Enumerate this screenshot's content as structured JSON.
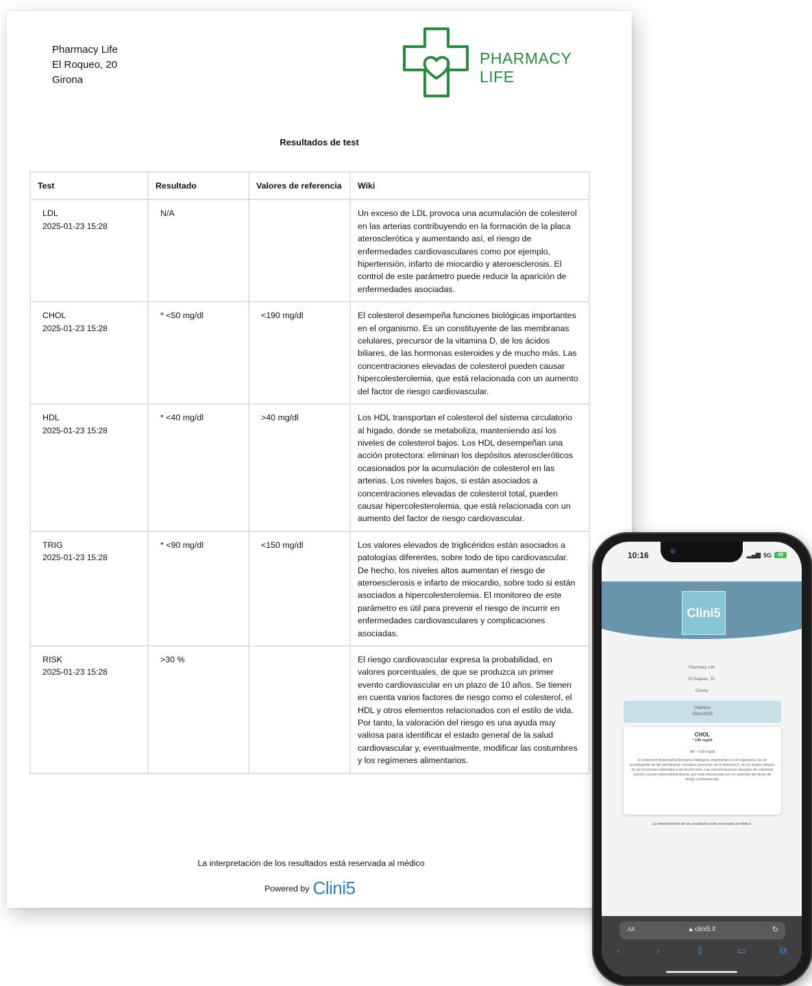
{
  "document": {
    "address": [
      "Pharmacy Life",
      "El Roqueo, 20",
      "Girona"
    ],
    "logo_text": [
      "PHARMACY",
      "LIFE"
    ],
    "colors": {
      "brand_green": "#2b8a3e",
      "clini5_blue": "#2e7fbf"
    },
    "title": "Resultados de test",
    "table": {
      "headers": [
        "Test",
        "Resultado",
        "Valores de referencia",
        "Wiki"
      ],
      "rows": [
        {
          "test": "LDL",
          "timestamp": "2025-01-23 15:28",
          "result": "N/A",
          "reference": "",
          "wiki": "Un exceso de LDL provoca una acumulación de colesterol en las arterias contribuyendo en la formación de la placa aterosclerótica y aumentando así, el riesgo de enfermedades cardiovasculares como por ejemplo, hipertensión, infarto de miocardio y ateroesclerosis. El control de este parámetro puede reducir la aparición de enfermedades asociadas."
        },
        {
          "test": "CHOL",
          "timestamp": "2025-01-23 15:28",
          "result": "* <50 mg/dl",
          "reference": "<190 mg/dl",
          "wiki": "El colesterol desempeña funciones biológicas importantes en el organismo. Es un constituyente de las membranas celulares, precursor de la vitamina D, de los ácidos biliares, de las hormonas esteroides y de mucho más. Las concentraciones elevadas de colesterol pueden causar hipercolesterolemia, que está relacionada con un aumento del factor de riesgo cardiovascular."
        },
        {
          "test": "HDL",
          "timestamp": "2025-01-23 15:28",
          "result": "* <40 mg/dl",
          "reference": ">40 mg/dl",
          "wiki": "Los HDL transportan el colesterol del sistema circulatorio al hígado, donde se metaboliza, manteniendo así los niveles de colesterol bajos. Los HDL desempeñan una acción protectora: eliminan los depósitos ateroscleróticos ocasionados por la acumulación de colesterol en las arterias. Los niveles bajos, si están asociados a concentraciones elevadas de colesterol total, pueden causar hipercolesterolemia, que está relacionada con un aumento del factor de riesgo cardiovascular."
        },
        {
          "test": "TRIG",
          "timestamp": "2025-01-23 15:28",
          "result": "* <90 mg/dl",
          "reference": "<150 mg/dl",
          "wiki": "Los valores elevados de triglicéridos están asociados a patologías diferentes, sobre todo de tipo cardiovascular. De hecho, los niveles altos aumentan el riesgo de ateroesclerosis e infarto de miocardio, sobre todo si están asociados a hipercolesterolemia. El monitoreo de este parámetro es útil para prevenir el riesgo de incurrir en enfermedades cardiovasculares y complicaciones asociadas."
        },
        {
          "test": "RISK",
          "timestamp": "2025-01-23 15:28",
          "result": ">30 %",
          "reference": "",
          "wiki": "El riesgo cardiovascular expresa la probabilidad, en valores porcentuales, de que se produzca un primer evento cardiovascular en un plazo de 10 años. Se tienen en cuenta varios factores de riesgo como el colesterol, el HDL y otros elementos relacionados con el estilo de vida. Por tanto, la valoración del riesgo es una ayuda muy valiosa para identificar el estado general de la salud cardiovascular y, eventualmente, modificar las costumbres y los regímenes alimentarios."
        }
      ]
    },
    "footer_note": "La interpretación de los resultados está reservada al médico",
    "powered_by": "Powered by",
    "powered_brand": "Clini5"
  },
  "phone": {
    "time": "10:16",
    "network": "5G",
    "battery": "45",
    "app_logo": "Clini5",
    "address": [
      "Pharmacy Life",
      "El Roqueo, 20",
      "Girona"
    ],
    "date_label": "Día/Hora",
    "date_value": "23/01/2025",
    "card": {
      "title": "CHOL",
      "value": "* 196 mg/dl",
      "reference": "MF: <190 mg/dl",
      "description": "El colesterol desempeña funciones biológicas importantes en el organismo. Es un constituyente de las membranas celulares, precursor de la vitamina D, de los ácidos biliares, de las hormonas esteroides y de mucho más. Las concentraciones elevadas de colesterol pueden causar hipercolesterolemia, que está relacionada con un aumento del factor de riesgo cardiovascular."
    },
    "footer": "La interpretación de los resultados está reservada al médico",
    "browser": {
      "text_size": "AA",
      "url": "clini5.it"
    },
    "colors": {
      "header": "#6a96ad",
      "logo_bg": "#86c4d8",
      "ios_blue": "#4a8fd9"
    }
  }
}
